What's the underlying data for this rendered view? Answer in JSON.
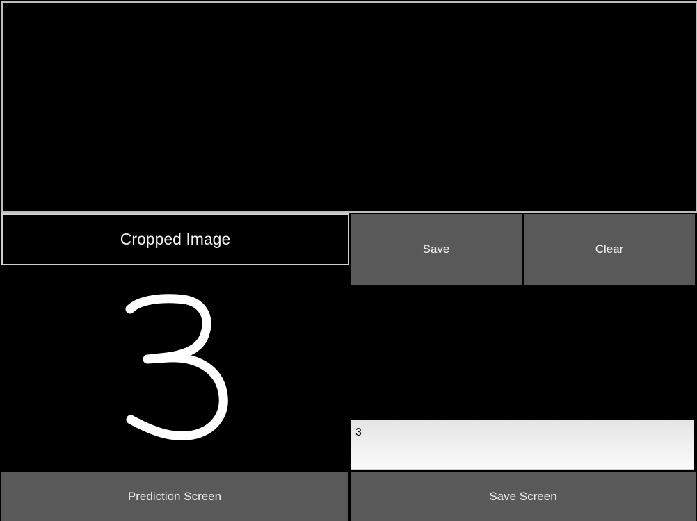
{
  "cropped_panel": {
    "title": "Cropped Image",
    "image_content": "3"
  },
  "buttons": {
    "save": "Save",
    "clear": "Clear",
    "prediction_screen": "Prediction Screen",
    "save_screen": "Save Screen"
  },
  "prediction": {
    "value": "3"
  },
  "colors": {
    "background": "#000000",
    "button": "#595959",
    "button_text": "#f0f0f0",
    "stroke": "#ffffff"
  }
}
